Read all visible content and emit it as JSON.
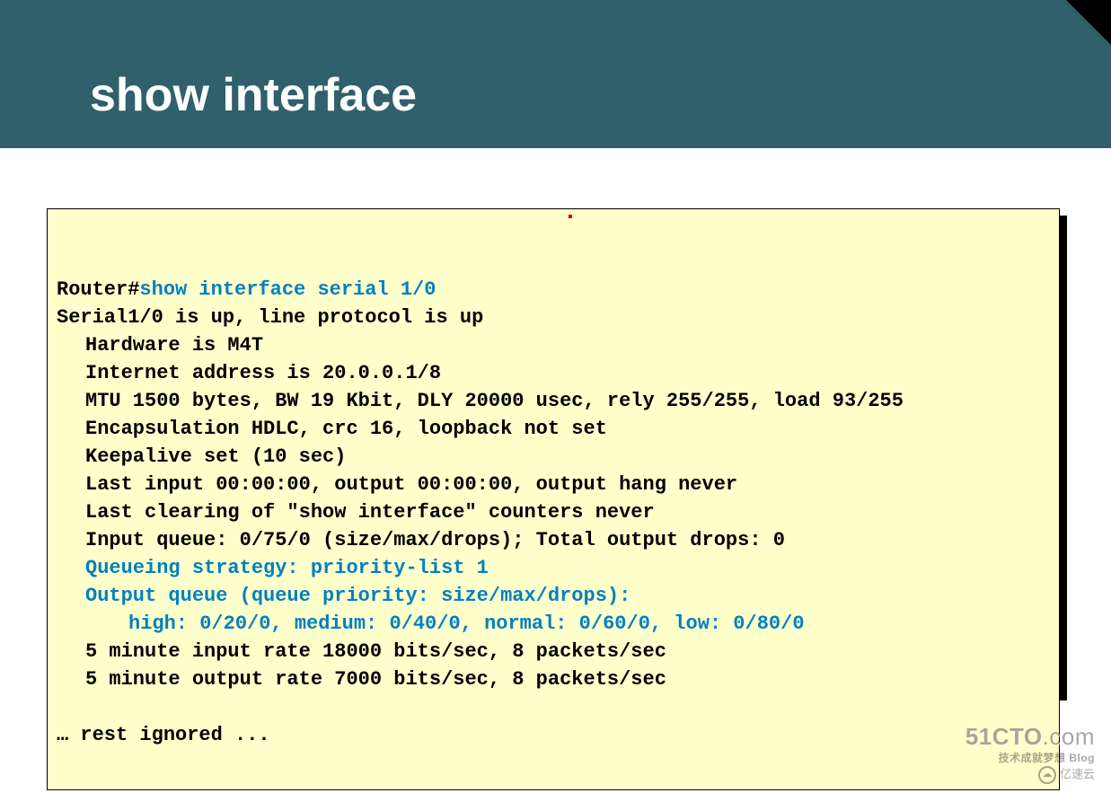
{
  "slide": {
    "title": "show interface"
  },
  "terminal": {
    "prompt": "Router#",
    "command": "show interface serial 1/0",
    "lines": {
      "l1": "Serial1/0 is up, line protocol is up",
      "l2": "Hardware is M4T",
      "l3": "Internet address is 20.0.0.1/8",
      "l4": "MTU 1500 bytes, BW 19 Kbit, DLY 20000 usec, rely 255/255, load 93/255",
      "l5": "Encapsulation HDLC, crc 16, loopback not set",
      "l6": "Keepalive set (10 sec)",
      "l7": "Last input 00:00:00, output 00:00:00, output hang never",
      "l8": "Last clearing of \"show interface\" counters never",
      "l9": "Input queue: 0/75/0 (size/max/drops); Total output drops: 0",
      "h1": "Queueing strategy: priority-list 1",
      "h2": "Output queue (queue priority: size/max/drops):",
      "h3": "high: 0/20/0, medium: 0/40/0, normal: 0/60/0, low: 0/80/0",
      "l10": "5 minute input rate 18000 bits/sec, 8 packets/sec",
      "l11": "5 minute output rate 7000 bits/sec, 8 packets/sec",
      "rest": "… rest ignored ..."
    }
  },
  "watermark": {
    "main_a": "51CTO",
    "main_b": ".com",
    "sub": "技术成就梦想   Blog",
    "secondary": "亿速云"
  }
}
